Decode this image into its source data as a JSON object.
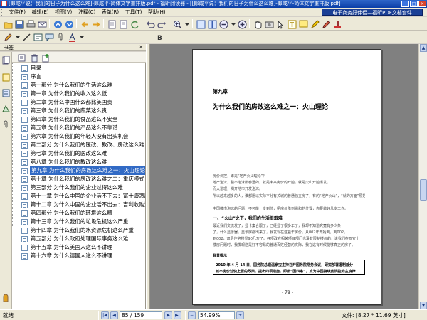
{
  "window": {
    "title": "[郎咸平说：我们的日子为什么这么难]-郎咸平-简体文字重排版.pdf - 福昕阅读器 - [[郎咸平说：我们的日子为什么这么难]-郎咸平-简体文字重排版.pdf]"
  },
  "menu": [
    "文件(F)",
    "编辑(E)",
    "视图(V)",
    "注释(C)",
    "表单(R)",
    "工具(T)",
    "帮助(H)"
  ],
  "ad_banner": "电子商务好伴侣—福昕PDF文档套件",
  "toolbar": {
    "font_value": "宋体"
  },
  "sidebar": {
    "header": "书签",
    "close": "×",
    "items": [
      {
        "label": "目录",
        "selected": false
      },
      {
        "label": "序言",
        "selected": false
      },
      {
        "label": "第一部分 为什么我们的生活这么难",
        "selected": false
      },
      {
        "label": "第一章 为什么我们的收入这么低",
        "selected": false
      },
      {
        "label": "第二章 为什么中国什么都比美国贵",
        "selected": false
      },
      {
        "label": "第三章 为什么我们的蔬菜这么贵",
        "selected": false
      },
      {
        "label": "第四章 为什么我们的食品这么不安全",
        "selected": false
      },
      {
        "label": "第五章 为什么我们的产品这么不靠谱",
        "selected": false
      },
      {
        "label": "第六章 为什么我们的年轻人没有出头机会",
        "selected": false
      },
      {
        "label": "第二部分 为什么我们的医改、教改、房改这么难",
        "selected": false
      },
      {
        "label": "第七章 为什么我们的医改这么难",
        "selected": false
      },
      {
        "label": "第八章 为什么我们的教改这么难",
        "selected": false
      },
      {
        "label": "第九章 为什么我们的房改这么难之一：火山理论",
        "selected": true
      },
      {
        "label": "第十章 为什么我们的房改这么难之二：重庆模式",
        "selected": false
      },
      {
        "label": "第三部分 为什么我们的企业过得这么难",
        "selected": false
      },
      {
        "label": "第十一章 为什么中国的企业活不下去：富士康悲剧",
        "selected": false
      },
      {
        "label": "第十二章 为什么中国的企业活不出去：吉利收购沃",
        "selected": false
      },
      {
        "label": "第四部分 为什么我们的环境这么糟",
        "selected": false
      },
      {
        "label": "第十三章 为什么我们的垃圾危机这么严重",
        "selected": false
      },
      {
        "label": "第十四章 为什么我们的水资源危机这么严重",
        "selected": false
      },
      {
        "label": "第五部分 为什么政府处理国际事务这么难",
        "selected": false
      },
      {
        "label": "第十五章 为什么美国人这么不讲理",
        "selected": false
      },
      {
        "label": "第十六章 为什么德国人这么不讲理",
        "selected": false
      }
    ]
  },
  "document": {
    "chapter": "第九章",
    "title": "为什么我们的房改这么难之一：火山理论",
    "para1": "房价调控，谁是“地产火山理论”？",
    "para2": "地产泡沫，股市泡沫所参透的，就是未来房价的开始，就是火山开始爆发。",
    "para3": "而大道理，揭开地市开发泡沫。",
    "para4": "所以越来越多的人，谁都愿以实际不分有关城的普通独立房了，有的“地产火山”，“就的方面”原始。",
    "para5": "中国楼市泡沫的问题，不可能一步到位，把房价降到温和的位置，你要做好几步工作。",
    "section": "一、“火山”之下，我们的生活很艰难",
    "body1": "最近我们交流发了，显卡集合跟了，已经显了很多年了，我却不知道究竟有多少条",
    "body2": "了，什么显示器，显示房都出来了，我发现在这些年房价，从002年开始到，到002，",
    "body3": "到002，双层住宅楼显90几万了。各项政府相关项目部门也没有限制楼价的，说我们在西安上",
    "body4": "楼房问题时，我发现这是好不容易的普通百姓经营的实际，我在这有时候能够真正的房子。",
    "box_label": "背景提示",
    "box_line1": "2010 年 4 月 14 日，国务院总理温家宝主持召开国务院常务会议，研究部署遏制部分",
    "box_line2": "城市房价过快上涨的政策，提出四项措施，即所“国四条”，成为中国持续房调控的主旋律",
    "page_number": "- 79 -"
  },
  "status": {
    "ready": "就绪",
    "page_current": "85 / 159",
    "zoom": "54.99%",
    "page_size": "文件: [8.27 * 11.69 英寸]"
  },
  "colors": {
    "titlebar": "#0a3ea8",
    "selection": "#316ac5",
    "ad_banner": "#1a3f95"
  }
}
